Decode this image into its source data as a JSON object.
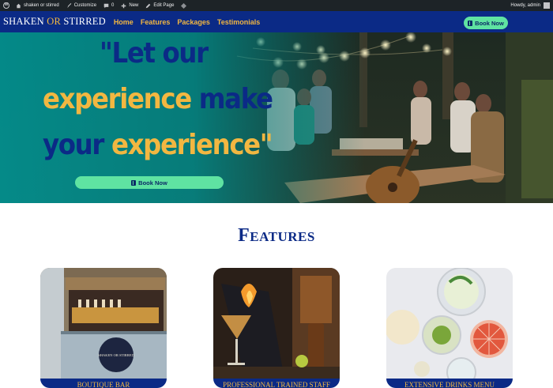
{
  "admin_bar": {
    "site_name": "shaken or stirred",
    "customize": "Customize",
    "comments_count": "0",
    "new_label": "New",
    "edit_page": "Edit Page",
    "greeting": "Howdy, admin"
  },
  "header": {
    "logo_part1": "SHAKEN ",
    "logo_part2": "OR",
    "logo_part3": " STIRRED",
    "nav": [
      "Home",
      "Features",
      "Packages",
      "Testimonials"
    ],
    "book_label": "Book Now"
  },
  "hero": {
    "line1_a": "\"Let our",
    "line2_a": "experience",
    "line2_b": " make",
    "line3_a": "your",
    "line3_b": " experience\"",
    "book_label": "Book Now"
  },
  "features": {
    "title": "Features",
    "cards": [
      {
        "label": "BOUTIQUE BAR"
      },
      {
        "label": "PROFESSIONAL TRAINED STAFF"
      },
      {
        "label": "EXTENSIVE DRINKS MENU"
      }
    ]
  },
  "colors": {
    "navy": "#0b2a86",
    "gold": "#f2b741",
    "mint": "#5fe3a2",
    "teal": "#009696",
    "admin_bar": "#1d2327"
  }
}
